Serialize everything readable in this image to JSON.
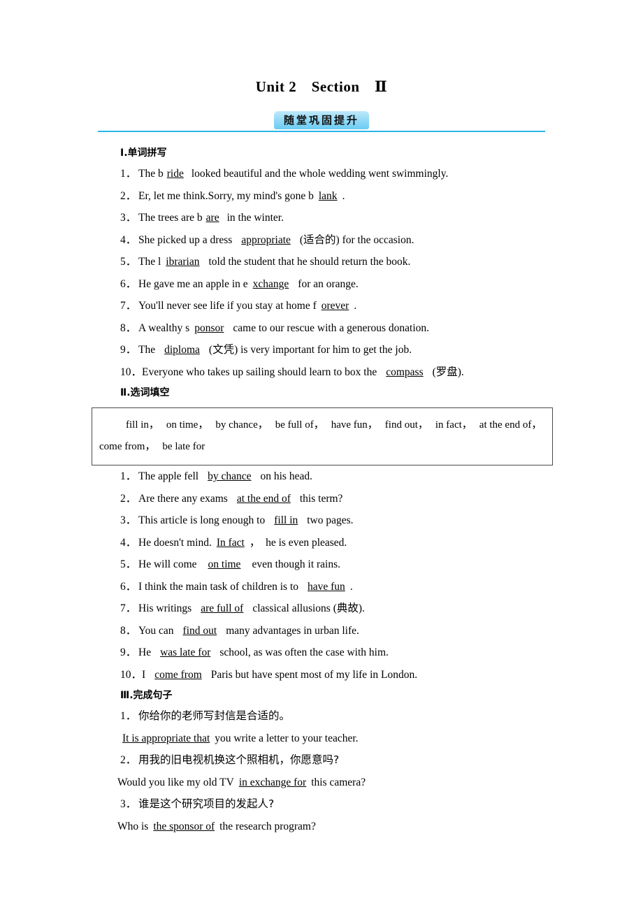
{
  "header": {
    "unit_title": "Unit 2　Section　Ⅱ",
    "banner_label": "随堂巩固提升"
  },
  "section1": {
    "heading": "Ⅰ.单词拼写",
    "items": [
      {
        "num": "1．",
        "before": "The b",
        "answer": "ride",
        "after": "looked beautiful and the whole wedding went swimmingly."
      },
      {
        "num": "2．",
        "before": "Er, let me think.Sorry, my mind's gone b",
        "answer": "lank",
        "after": "."
      },
      {
        "num": "3．",
        "before": "The trees are b",
        "answer": "are",
        "after": "in the winter."
      },
      {
        "num": "4．",
        "before": "She picked up a dress",
        "answer": "appropriate",
        "after": "(适合的) for the occasion."
      },
      {
        "num": "5．",
        "before": "The l",
        "answer": "ibrarian",
        "after": "told the student that he should return the book."
      },
      {
        "num": "6．",
        "before": "He gave me an apple in e",
        "answer": "xchange",
        "after": "for an orange."
      },
      {
        "num": "7．",
        "before": "You'll never see life if you stay at home f",
        "answer": "orever",
        "after": "."
      },
      {
        "num": "8．",
        "before": "A wealthy s",
        "answer": "ponsor",
        "after": "came to our rescue with a generous donation."
      },
      {
        "num": "9．",
        "before": "The",
        "answer": "diploma",
        "after": "(文凭) is very important for him to get the job."
      },
      {
        "num": "10．",
        "before": "Everyone who takes up sailing should learn to box the",
        "answer": "compass",
        "after": "(罗盘)."
      }
    ]
  },
  "section2": {
    "heading": "Ⅱ.选词填空",
    "wordbank_row1": [
      "fill in，",
      "on time，",
      "by chance，",
      "be full of，",
      "have fun，",
      "find out，",
      "in fact，",
      "at the end of，"
    ],
    "wordbank_row2": [
      "come from，",
      "be late for"
    ],
    "items": [
      {
        "num": "1．",
        "before": "The apple fell",
        "answer": "by chance",
        "after": "on his head."
      },
      {
        "num": "2．",
        "before": "Are there any exams",
        "answer": "at the end of",
        "after": "this term?"
      },
      {
        "num": "3．",
        "before": "This article is long enough to",
        "answer": "fill in",
        "after": "two pages."
      },
      {
        "num": "4．",
        "before": "He doesn't mind.",
        "answer": "In fact",
        "after": "，　he is even pleased."
      },
      {
        "num": "5．",
        "before": "He will come",
        "answer": "on time",
        "after": "even though it rains."
      },
      {
        "num": "6．",
        "before": "I think the main task of children is to",
        "answer": "have fun",
        "after": "."
      },
      {
        "num": "7．",
        "before": "His writings",
        "answer": "are full of",
        "after": "classical allusions (典故)."
      },
      {
        "num": "8．",
        "before": "You can",
        "answer": "find out",
        "after": "many advantages in urban life."
      },
      {
        "num": "9．",
        "before": "He",
        "answer": "was late for",
        "after": "school, as was often the case with him."
      },
      {
        "num": "10．",
        "before": "I",
        "answer": "come from",
        "after": "Paris but have spent most of my life in London."
      }
    ]
  },
  "section3": {
    "heading": "Ⅲ.完成句子",
    "items": [
      {
        "num": "1．",
        "prompt": "你给你的老师写封信是合适的。",
        "before": "",
        "answer": "It is appropriate that",
        "after": "you write a letter to your teacher."
      },
      {
        "num": "2．",
        "prompt": "用我的旧电视机换这个照相机，你愿意吗?",
        "before": "Would you like my old TV",
        "answer": "in exchange for",
        "after": "this camera?"
      },
      {
        "num": "3．",
        "prompt": "谁是这个研究项目的发起人?",
        "before": "Who is",
        "answer": "the sponsor of",
        "after": "the research program?"
      }
    ]
  },
  "colors": {
    "rule": "#29b6ea",
    "banner_light": "#bfe9fb",
    "banner_dark": "#6ccdf3",
    "box_border": "#4a4a4a"
  }
}
